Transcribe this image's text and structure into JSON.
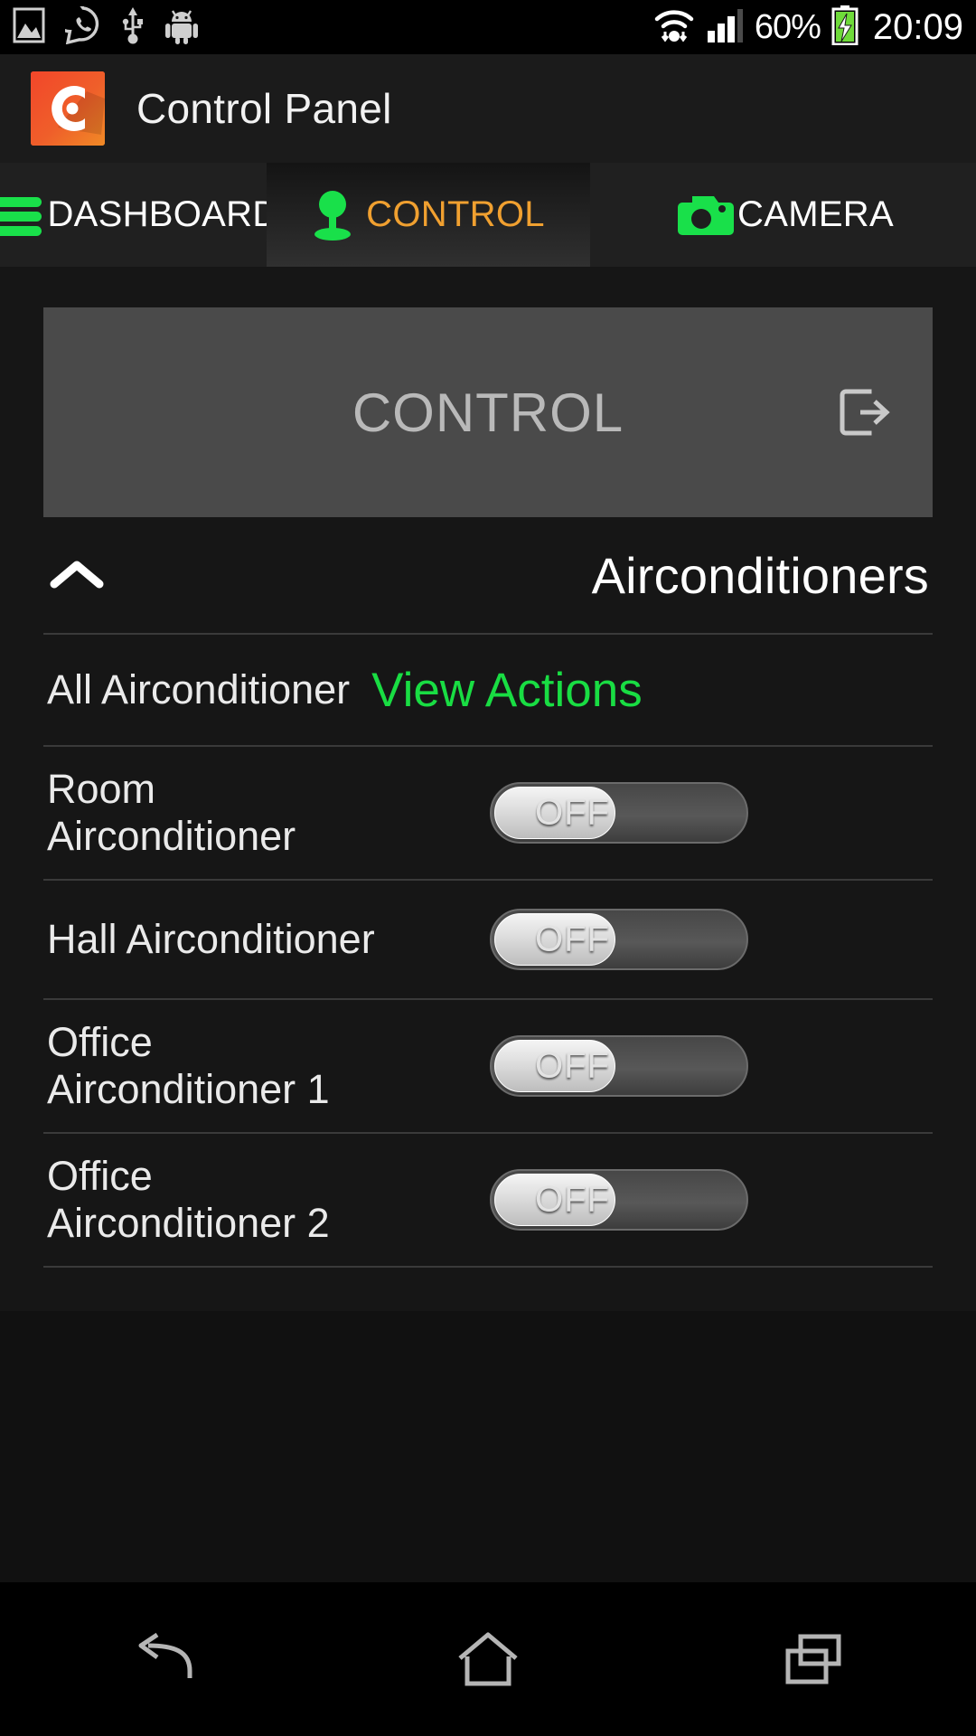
{
  "statusbar": {
    "icons": [
      "gallery-icon",
      "whatsapp-icon",
      "usb-icon",
      "android-icon"
    ],
    "wifi": "wifi-icon",
    "signal": "signal-bars-icon",
    "battery_percent": "60%",
    "battery": "battery-charging-icon",
    "time": "20:09"
  },
  "appbar": {
    "logo": "app-logo-icon",
    "title": "Control Panel"
  },
  "tabs": [
    {
      "label": "DASHBOARD",
      "icon": "hamburger-menu-icon",
      "active": false
    },
    {
      "label": "CONTROL",
      "icon": "joystick-person-icon",
      "active": true
    },
    {
      "label": "CAMERA",
      "icon": "camera-icon",
      "active": false
    }
  ],
  "panel": {
    "title": "CONTROL",
    "exit_icon": "exit-to-app-icon"
  },
  "section": {
    "collapse_icon": "chevron-up-icon",
    "title": "Airconditioners"
  },
  "rows": [
    {
      "label": "All Airconditioner",
      "type": "action",
      "action": "View Actions"
    },
    {
      "label": "Room\nAirconditioner",
      "type": "toggle",
      "state": "OFF"
    },
    {
      "label": "Hall Airconditioner",
      "type": "toggle",
      "state": "OFF"
    },
    {
      "label": "Office\nAirconditioner 1",
      "type": "toggle",
      "state": "OFF"
    },
    {
      "label": "Office\nAirconditioner 2",
      "type": "toggle",
      "state": "OFF"
    }
  ],
  "row_labels": {
    "r0": "All Airconditioner",
    "r0_action": "View Actions",
    "r1_line1": "Room",
    "r1_line2": "Airconditioner",
    "r1_state": "OFF",
    "r2": "Hall Airconditioner",
    "r2_state": "OFF",
    "r3_line1": "Office",
    "r3_line2": "Airconditioner 1",
    "r3_state": "OFF",
    "r4_line1": "Office",
    "r4_line2": "Airconditioner 2",
    "r4_state": "OFF"
  },
  "navbar": {
    "back": "back-icon",
    "home": "home-icon",
    "recents": "recents-icon"
  },
  "colors": {
    "accent_green": "#19dd43",
    "accent_orange": "#f0a030",
    "panel_grey": "#4a4a4a",
    "background": "#161616"
  }
}
